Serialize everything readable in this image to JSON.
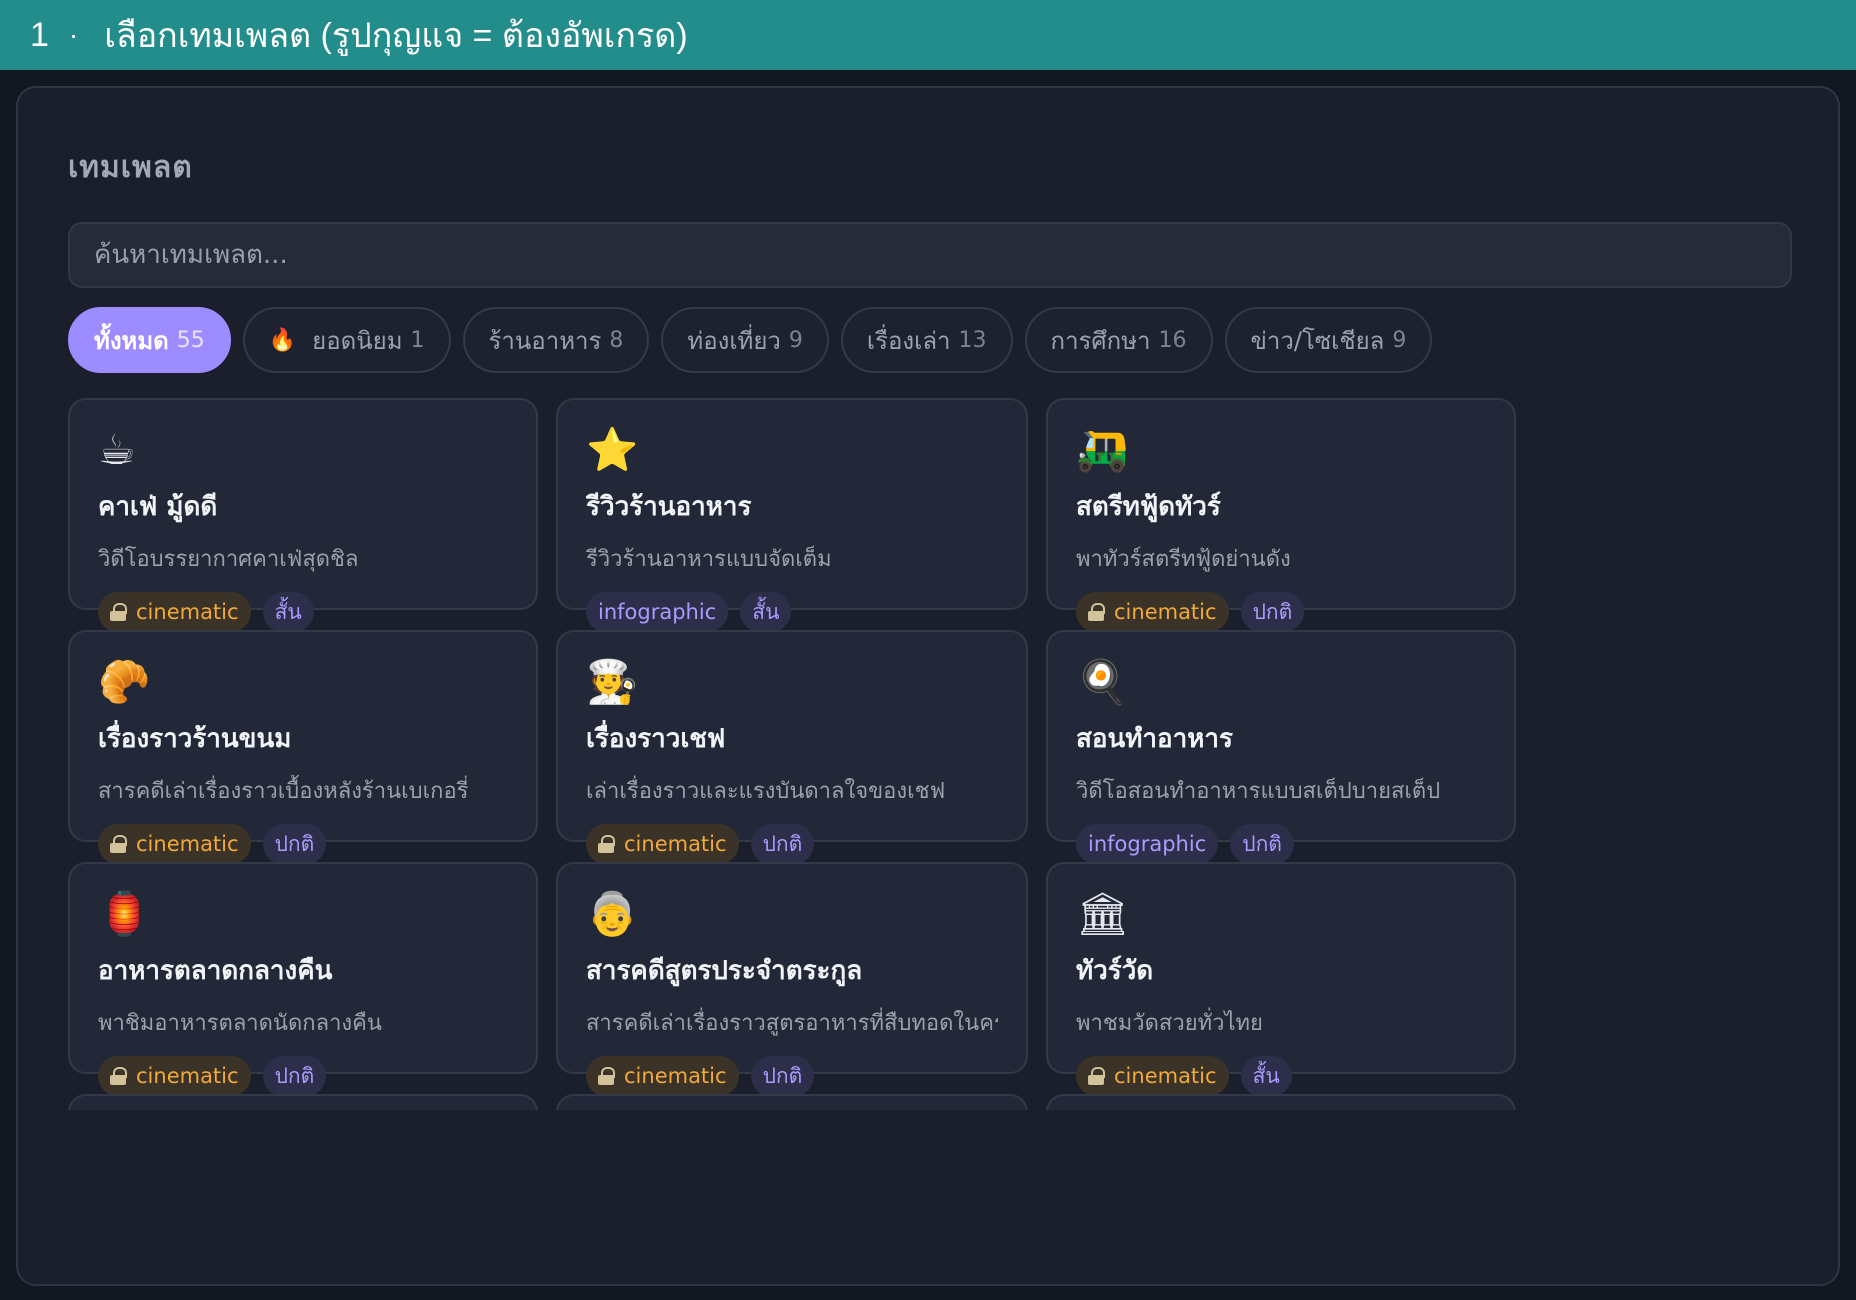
{
  "step": {
    "number": "1",
    "separator": "·",
    "title": "เลือกเทมเพลต (รูปกุญแจ = ต้องอัพเกรด)"
  },
  "panel": {
    "title": "เทมเพลต"
  },
  "search": {
    "placeholder": "ค้นหาเทมเพลต..."
  },
  "tabs": [
    {
      "label": "ทั้งหมด",
      "count": "55",
      "active": true
    },
    {
      "label": "ยอดนิยม",
      "count": "1",
      "icon": "fire-icon"
    },
    {
      "label": "ร้านอาหาร",
      "count": "8"
    },
    {
      "label": "ท่องเที่ยว",
      "count": "9"
    },
    {
      "label": "เรื่องเล่า",
      "count": "13"
    },
    {
      "label": "การศึกษา",
      "count": "16"
    },
    {
      "label": "ข่าว/โซเชียล",
      "count": "9"
    }
  ],
  "cards": [
    {
      "icon": "coffee-icon",
      "emoji": "☕",
      "title": "คาเฟ่ มู้ดดี",
      "desc": "วิดีโอบรรยากาศคาเฟ่สุดชิล",
      "style": "cinematic",
      "locked": true,
      "length": "สั้น"
    },
    {
      "icon": "star-icon",
      "emoji": "⭐",
      "title": "รีวิวร้านอาหาร",
      "desc": "รีวิวร้านอาหารแบบจัดเต็ม",
      "style": "infographic",
      "locked": false,
      "length": "สั้น"
    },
    {
      "icon": "tuk-tuk-icon",
      "emoji": "🛺",
      "title": "สตรีทฟู้ดทัวร์",
      "desc": "พาทัวร์สตรีทฟู้ดย่านดัง",
      "style": "cinematic",
      "locked": true,
      "length": "ปกติ"
    },
    {
      "icon": "croissant-icon",
      "emoji": "🥐",
      "title": "เรื่องราวร้านขนม",
      "desc": "สารคดีเล่าเรื่องราวเบื้องหลังร้านเบเกอรี่",
      "style": "cinematic",
      "locked": true,
      "length": "ปกติ"
    },
    {
      "icon": "chef-icon",
      "emoji": "🧑‍🍳",
      "title": "เรื่องราวเชฟ",
      "desc": "เล่าเรื่องราวและแรงบันดาลใจของเชฟ",
      "style": "cinematic",
      "locked": true,
      "length": "ปกติ"
    },
    {
      "icon": "frying-pan-icon",
      "emoji": "🍳",
      "title": "สอนทำอาหาร",
      "desc": "วิดีโอสอนทำอาหารแบบสเต็ปบายสเต็ป",
      "style": "infographic",
      "locked": false,
      "length": "ปกติ"
    },
    {
      "icon": "lantern-icon",
      "emoji": "🏮",
      "title": "อาหารตลาดกลางคืน",
      "desc": "พาชิมอาหารตลาดนัดกลางคืน",
      "style": "cinematic",
      "locked": true,
      "length": "ปกติ"
    },
    {
      "icon": "grandmother-icon",
      "emoji": "👵",
      "title": "สารคดีสูตรประจำตระกูล",
      "desc": "สารคดีเล่าเรื่องราวสูตรอาหารที่สืบทอดในครอบครัว",
      "style": "cinematic",
      "locked": true,
      "length": "ปกติ"
    },
    {
      "icon": "temple-icon",
      "emoji": "🏛",
      "title": "ทัวร์วัด",
      "desc": "พาชมวัดสวยทั่วไทย",
      "style": "cinematic",
      "locked": true,
      "length": "สั้น"
    }
  ],
  "colors": {
    "header": "#238d8b",
    "accent": "#9c8cff",
    "cinematic": "#f0a93a",
    "infographic": "#a99cff",
    "background": "#131722",
    "card": "#232838"
  }
}
